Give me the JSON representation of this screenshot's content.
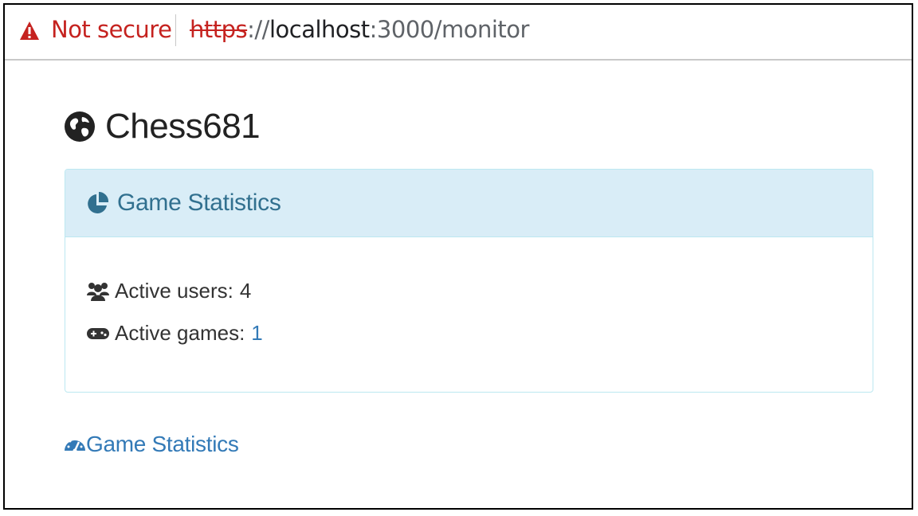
{
  "browser": {
    "security_label": "Not secure",
    "url_scheme": "https",
    "url_separator": "://",
    "url_host": "localhost",
    "url_rest": ":3000/monitor"
  },
  "page": {
    "title": "Chess681",
    "title_icon": "globe-icon"
  },
  "panel": {
    "title": "Game Statistics",
    "title_icon": "pie-chart-icon",
    "stats": [
      {
        "icon": "users-icon",
        "label": "Active users:",
        "value": "4"
      },
      {
        "icon": "gamepad-icon",
        "label": "Active games:",
        "value": "1"
      }
    ]
  },
  "footer": {
    "link_label": "Game Statistics",
    "link_icon": "dashboard-icon"
  },
  "colors": {
    "warning_red": "#c5221f",
    "panel_bg": "#d9edf7",
    "panel_border": "#bce8f1",
    "panel_title": "#31708f",
    "link_blue": "#337ab7"
  }
}
